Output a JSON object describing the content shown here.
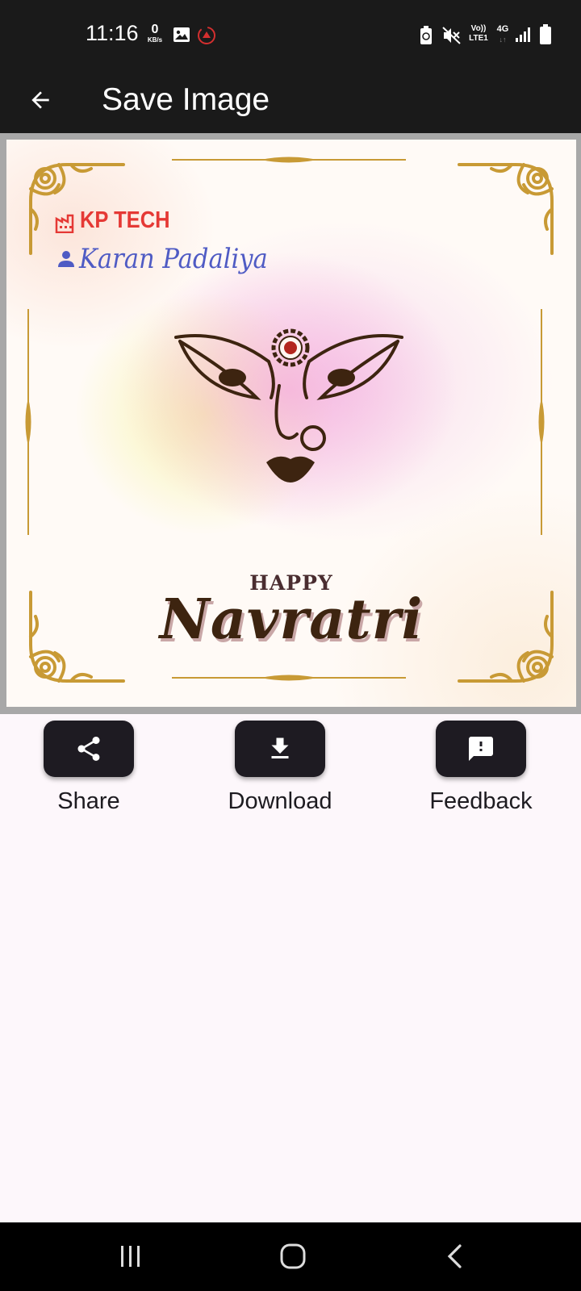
{
  "status_bar": {
    "time": "11:16",
    "net_speed_value": "0",
    "net_speed_unit": "KB/s",
    "network_label_top": "Vo))",
    "network_label_bottom": "LTE1",
    "network_type": "4G",
    "icons": [
      "gallery-icon",
      "app-notification-icon",
      "battery-saver-icon",
      "mute-icon",
      "signal-icon",
      "battery-icon"
    ]
  },
  "app_bar": {
    "title": "Save Image",
    "back_icon": "arrow-back-icon"
  },
  "card": {
    "brand_name": "KP TECH",
    "person_name": "Karan Padaliya",
    "greeting_line1": "HAPPY",
    "greeting_line2": "Navratri",
    "colors": {
      "brand": "#e53935",
      "person": "#4f5bc4",
      "gold": "#c89a35",
      "art": "#3d2410"
    }
  },
  "actions": [
    {
      "label": "Share",
      "icon": "share-icon"
    },
    {
      "label": "Download",
      "icon": "download-icon"
    },
    {
      "label": "Feedback",
      "icon": "feedback-icon"
    }
  ],
  "nav_bar": {
    "icons": [
      "recent-apps-icon",
      "home-icon",
      "back-icon"
    ]
  },
  "theme": {
    "app_bar_bg": "#1a1a1a",
    "page_bg": "#fdf7fb",
    "button_bg": "#1e1b22"
  }
}
